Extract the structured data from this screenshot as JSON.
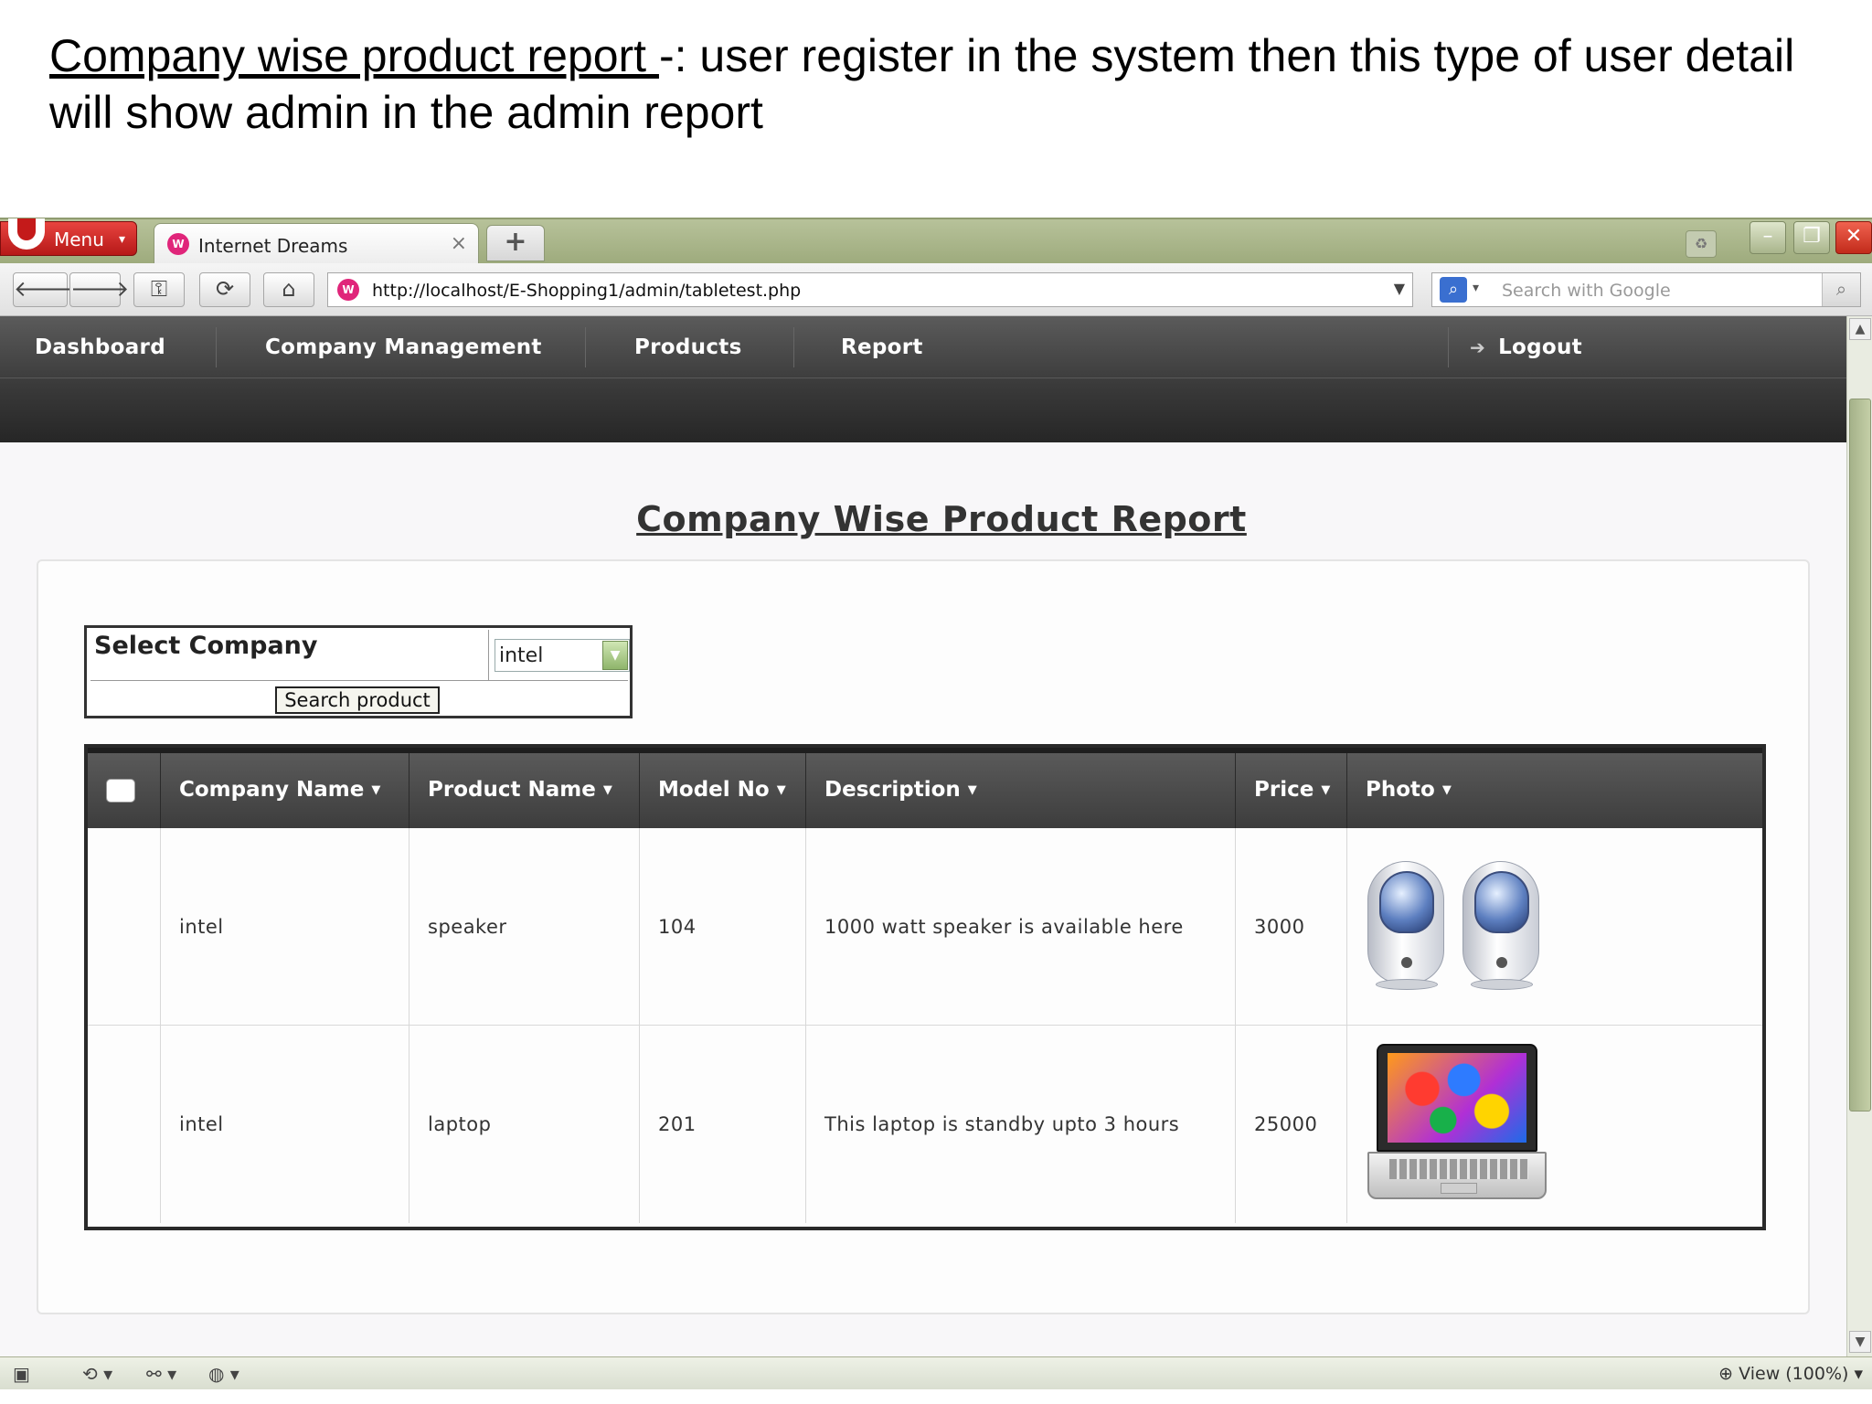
{
  "caption": {
    "title": "Company wise product report ",
    "rest": "-: user register in the system then this type of user detail will show admin in the admin report"
  },
  "browser": {
    "menu_label": "Menu",
    "tab_title": "Internet Dreams",
    "tab_close_icon": "×",
    "new_tab_icon": "+",
    "url": "http://localhost/E-Shopping1/admin/tabletest.php",
    "search_placeholder": "Search with Google",
    "zoom_label": "View (100%)"
  },
  "app_nav": {
    "items": [
      "Dashboard",
      "Company Management",
      "Products",
      "Report"
    ],
    "logout": "Logout"
  },
  "report": {
    "title": "Company Wise Product Report",
    "filter": {
      "label": "Select Company",
      "selected": "intel",
      "options": [
        "intel"
      ],
      "button": "Search product"
    },
    "columns": [
      "Company Name",
      "Product Name",
      "Model No",
      "Description",
      "Price",
      "Photo"
    ],
    "rows": [
      {
        "company": "intel",
        "product": "speaker",
        "model": "104",
        "description": "1000 watt speaker is available here",
        "price": "3000",
        "photo": "speaker-pair-image"
      },
      {
        "company": "intel",
        "product": "laptop",
        "model": "201",
        "description": "This laptop is standby upto 3 hours",
        "price": "25000",
        "photo": "laptop-image"
      }
    ]
  },
  "colors": {
    "nav_dark": "#3a3a3a",
    "browser_chrome": "#9eab7d",
    "panel_bg": "#fdfdfd"
  }
}
